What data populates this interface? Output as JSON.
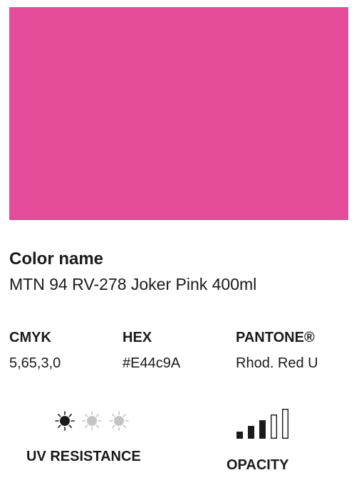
{
  "swatch": {
    "color": "#E44C9A"
  },
  "color_info": {
    "title": "Color name",
    "name": "MTN 94 RV-278 Joker Pink 400ml"
  },
  "specs": {
    "cmyk": {
      "label": "CMYK",
      "value": "5,65,3,0"
    },
    "hex": {
      "label": "HEX",
      "value": "#E44c9A"
    },
    "pantone": {
      "label": "PANTONE®",
      "value": "Rhod. Red U"
    }
  },
  "uv_resistance": {
    "label": "UV RESISTANCE",
    "rating": 1,
    "max": 3,
    "icon": "sun-icon",
    "active_color": "#1a1a1a",
    "inactive_color": "#c4c4c4"
  },
  "opacity": {
    "label": "OPACITY",
    "rating": 3,
    "max": 5,
    "icon": "bar-level-icon",
    "active_color": "#1a1a1a"
  }
}
